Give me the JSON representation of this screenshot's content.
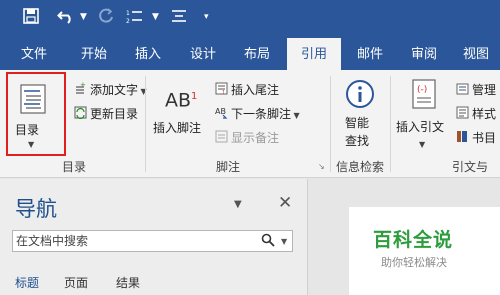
{
  "ribbon_tabs": [
    "文件",
    "开始",
    "插入",
    "设计",
    "布局",
    "引用",
    "邮件",
    "审阅",
    "视图"
  ],
  "active_tab": "引用",
  "toc_group": {
    "toc_button": "目录",
    "add_text": "添加文字",
    "update_toc": "更新目录",
    "label": "目录"
  },
  "footnotes_group": {
    "insert_footnote": "插入脚注",
    "insert_endnote": "插入尾注",
    "next_footnote": "下一条脚注",
    "show_notes": "显示备注",
    "label": "脚注"
  },
  "research_group": {
    "smart_lookup_line1": "智能",
    "smart_lookup_line2": "查找",
    "label": "信息检索"
  },
  "citations_group": {
    "insert_citation": "插入引文",
    "manage": "管理",
    "style": "样式",
    "bibliography": "书目",
    "label": "引文与"
  },
  "nav_pane": {
    "title": "导航",
    "search_placeholder": "在文档中搜索",
    "tabs": [
      "标题",
      "页面",
      "结果"
    ]
  },
  "watermark": {
    "title": "百科全说",
    "subtitle": "助你轻松解决"
  },
  "colors": {
    "brand_blue": "#2b579a",
    "highlight_red": "#e02020",
    "watermark_green": "#2d9c3c"
  }
}
